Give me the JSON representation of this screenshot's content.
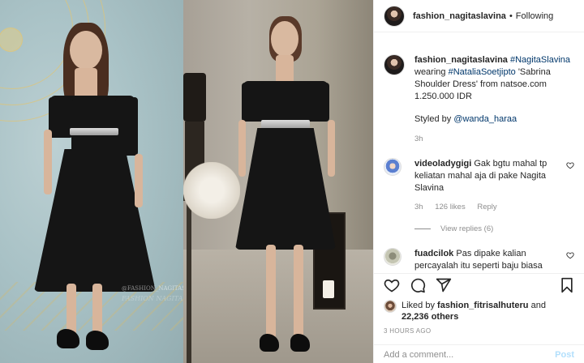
{
  "post": {
    "username": "fashion_nagitaslavina",
    "follow_label": "Following",
    "separator": "•"
  },
  "caption": {
    "username": "fashion_nagitaslavina",
    "hashtag1": "#NagitaSlavina",
    "text1": "wearing",
    "hashtag2": "#NataliaSoetjipto",
    "text2": "'Sabrina Shoulder Dress' from natsoe.com 1.250.000 IDR",
    "styled_by_text": "Styled by",
    "styled_by_user": "@wanda_haraa",
    "time": "3h"
  },
  "comments": [
    {
      "username": "videoladygigi",
      "text": "Gak bgtu mahal tp keliatan mahal aja di pake Nagita Slavina",
      "time": "3h",
      "likes": "126 likes",
      "reply_label": "Reply",
      "view_replies": "View replies (6)"
    },
    {
      "username": "fuadcilok",
      "text": "Pas dipake kalian percayalah itu seperti baju biasa"
    }
  ],
  "likes": {
    "prefix": "Liked by",
    "user": "fashion_fitrisalhuteru",
    "connector": "and",
    "others": "22,236 others"
  },
  "timestamp": "3 HOURS AGO",
  "add_comment": {
    "placeholder": "Add a comment...",
    "post_label": "Post"
  },
  "watermark": {
    "handle1": "@FASHION_NAGITASLAVINA",
    "handle2": "FASHION NAGITA"
  },
  "icons": [
    "heart-icon",
    "comment-icon",
    "share-icon",
    "bookmark-icon",
    "like-comment-icon"
  ],
  "colors": {
    "link": "#00376b",
    "muted": "#8e8e8e",
    "post_disabled": "#b2dffc"
  }
}
